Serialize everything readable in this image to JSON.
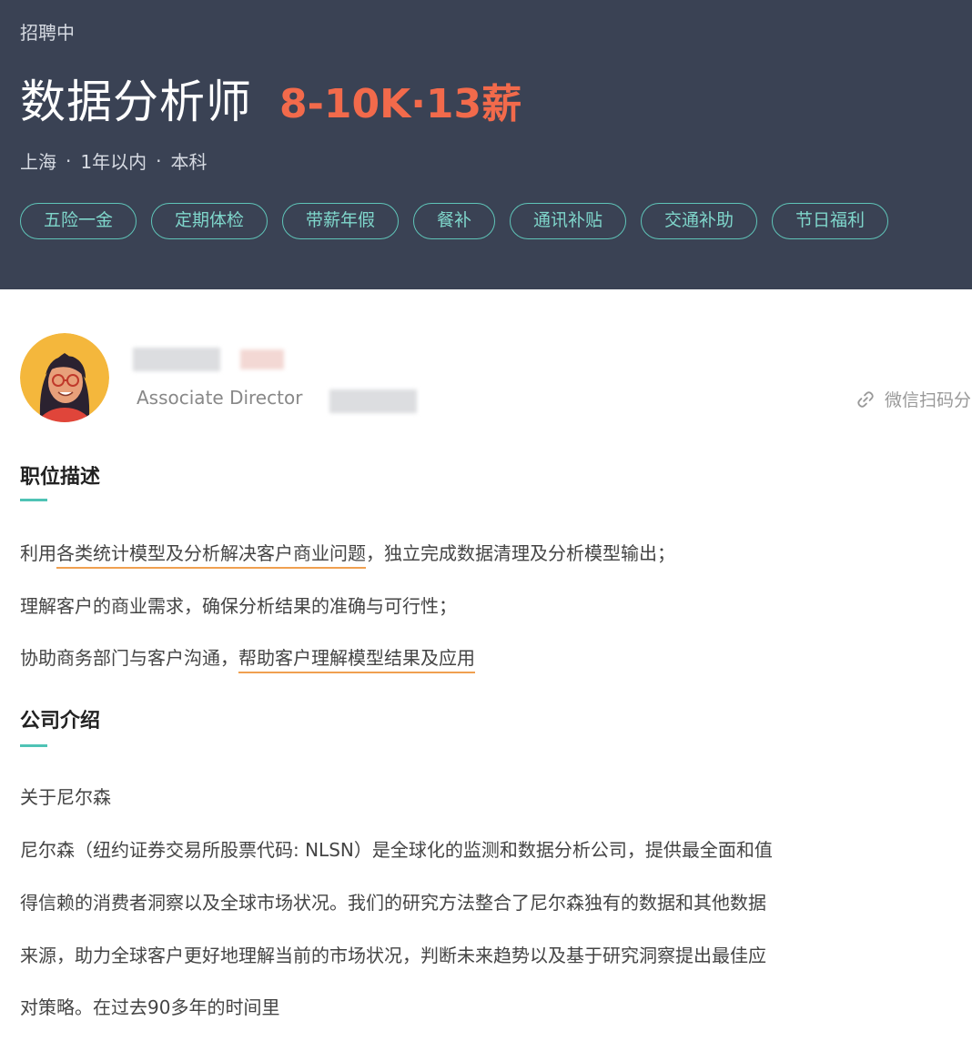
{
  "header": {
    "status": "招聘中",
    "job_title": "数据分析师",
    "salary": "8-10K·13薪",
    "location": "上海",
    "experience": "1年以内",
    "education": "本科",
    "separator": "·",
    "tags": [
      "五险一金",
      "定期体检",
      "带薪年假",
      "餐补",
      "通讯补贴",
      "交通补助",
      "节日福利"
    ]
  },
  "recruiter": {
    "role": "Associate Director",
    "share_label": "微信扫码分"
  },
  "job_description": {
    "title": "职位描述",
    "line1_prefix": "利用",
    "line1_highlight": "各类统计模型及分析解决客户商业问题",
    "line1_suffix": "，独立完成数据清理及分析模型输出；",
    "line2": "理解客户的商业需求，确保分析结果的准确与可行性；",
    "line3_prefix": "协助商务部门与客户沟通，",
    "line3_highlight": "帮助客户理解模型结果及应用"
  },
  "company": {
    "title": "公司介绍",
    "subtitle": "关于尼尔森",
    "lines": [
      "尼尔森（纽约证券交易所股票代码: NLSN）是全球化的监测和数据分析公司，提供最全面和值",
      "得信赖的消费者洞察以及全球市场状况。我们的研究方法整合了尼尔森独有的数据和其他数据",
      "来源，助力全球客户更好地理解当前的市场状况，判断未来趋势以及基于研究洞察提出最佳应",
      "对策略。在过去90多年的时间里"
    ]
  },
  "colors": {
    "header_bg": "#3a4254",
    "salary": "#f26a4b",
    "tag_border": "#5fc4b8",
    "accent": "#4fc3b5",
    "underline": "#f0a050"
  }
}
